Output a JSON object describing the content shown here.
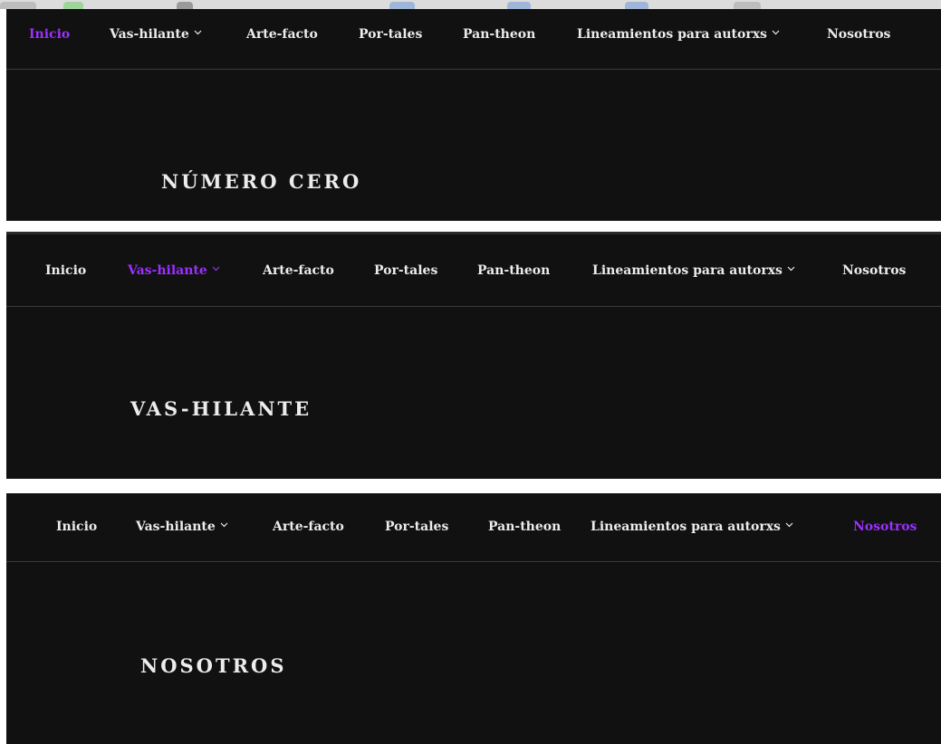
{
  "colors": {
    "background": "#111111",
    "text": "#ececec",
    "active": "#9b30ff",
    "separator": "#3a3a3a"
  },
  "panels": [
    {
      "nav": {
        "inicio": "Inicio",
        "vas_hilante": "Vas-hilante",
        "arte_facto": "Arte-facto",
        "por_tales": "Por-tales",
        "pan_theon": "Pan-theon",
        "lineamientos": "Lineamientos para autorxs",
        "nosotros": "Nosotros",
        "active": "Inicio"
      },
      "title": "NÚMERO CERO"
    },
    {
      "nav": {
        "inicio": "Inicio",
        "vas_hilante": "Vas-hilante",
        "arte_facto": "Arte-facto",
        "por_tales": "Por-tales",
        "pan_theon": "Pan-theon",
        "lineamientos": "Lineamientos para autorxs",
        "nosotros": "Nosotros",
        "active": "Vas-hilante"
      },
      "title": "VAS-HILANTE"
    },
    {
      "nav": {
        "inicio": "Inicio",
        "vas_hilante": "Vas-hilante",
        "arte_facto": "Arte-facto",
        "por_tales": "Por-tales",
        "pan_theon": "Pan-theon",
        "lineamientos": "Lineamientos para autorxs",
        "nosotros": "Nosotros",
        "active": "Nosotros"
      },
      "title": "NOSOTROS"
    }
  ]
}
